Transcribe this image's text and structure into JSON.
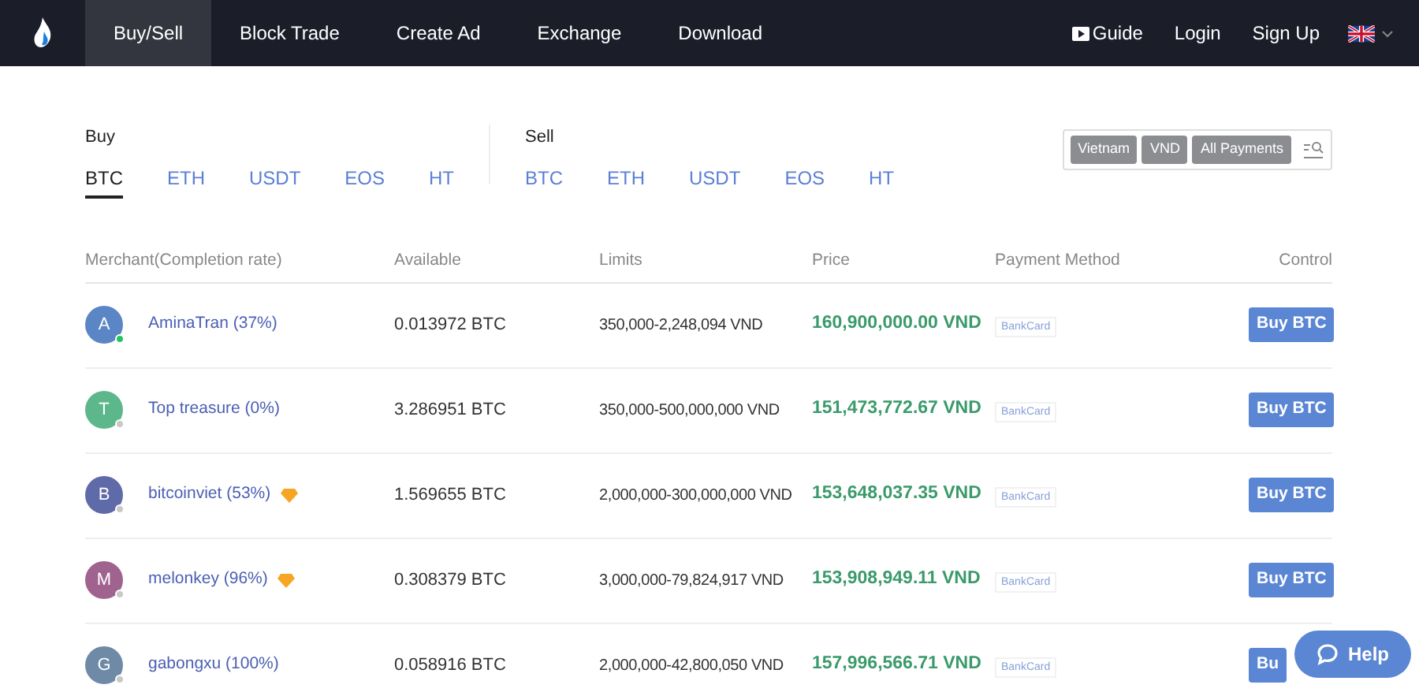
{
  "nav": {
    "items": [
      {
        "label": "Buy/Sell",
        "selected": true
      },
      {
        "label": "Block Trade",
        "selected": false
      },
      {
        "label": "Create Ad",
        "selected": false
      },
      {
        "label": "Exchange",
        "selected": false
      },
      {
        "label": "Download",
        "selected": false
      }
    ],
    "right": [
      {
        "label": "Guide",
        "kind": "video"
      },
      {
        "label": "Login",
        "kind": "link"
      },
      {
        "label": "Sign Up",
        "kind": "link"
      }
    ]
  },
  "buy": {
    "title": "Buy",
    "coins": [
      {
        "label": "BTC",
        "selected": true
      },
      {
        "label": "ETH",
        "selected": false
      },
      {
        "label": "USDT",
        "selected": false
      },
      {
        "label": "EOS",
        "selected": false
      },
      {
        "label": "HT",
        "selected": false
      }
    ]
  },
  "sell": {
    "title": "Sell",
    "coins": [
      {
        "label": "BTC",
        "selected": false
      },
      {
        "label": "ETH",
        "selected": false
      },
      {
        "label": "USDT",
        "selected": false
      },
      {
        "label": "EOS",
        "selected": false
      },
      {
        "label": "HT",
        "selected": false
      }
    ]
  },
  "filters": [
    "Vietnam",
    "VND",
    "All Payments"
  ],
  "table": {
    "columns": [
      "Merchant(Completion rate)",
      "Available",
      "Limits",
      "Price",
      "Payment Method",
      "Control"
    ],
    "rows": [
      {
        "initial": "A",
        "color": "#5b86c5",
        "online": true,
        "merchant": "AminaTran (37%)",
        "badge": false,
        "available": "0.013972 BTC",
        "limits": "350,000-2,248,094 VND",
        "price": "160,900,000.00 VND",
        "payment": "BankCard",
        "action": "Buy BTC"
      },
      {
        "initial": "T",
        "color": "#5cb88a",
        "online": false,
        "merchant": "Top treasure (0%)",
        "badge": false,
        "available": "3.286951 BTC",
        "limits": "350,000-500,000,000 VND",
        "price": "151,473,772.67 VND",
        "payment": "BankCard",
        "action": "Buy BTC"
      },
      {
        "initial": "B",
        "color": "#5f6aa8",
        "online": false,
        "merchant": "bitcoinviet (53%)",
        "badge": true,
        "available": "1.569655 BTC",
        "limits": "2,000,000-300,000,000 VND",
        "price": "153,648,037.35 VND",
        "payment": "BankCard",
        "action": "Buy BTC"
      },
      {
        "initial": "M",
        "color": "#a0628e",
        "online": false,
        "merchant": "melonkey (96%)",
        "badge": true,
        "available": "0.308379 BTC",
        "limits": "3,000,000-79,824,917 VND",
        "price": "153,908,949.11 VND",
        "payment": "BankCard",
        "action": "Buy BTC"
      },
      {
        "initial": "G",
        "color": "#6f8aa6",
        "online": false,
        "merchant": "gabongxu (100%)",
        "badge": false,
        "available": "0.058916 BTC",
        "limits": "2,000,000-42,800,050 VND",
        "price": "157,996,566.71 VND",
        "payment": "BankCard",
        "action": "Bu"
      }
    ]
  },
  "help": {
    "label": "Help"
  }
}
